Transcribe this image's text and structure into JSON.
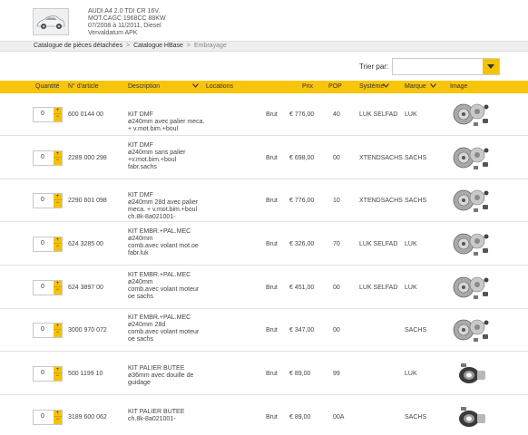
{
  "vehicle": {
    "lines": [
      "AUDI A4 2.0 TDI CR 16V.",
      "MOT.CAGC 1968CC 88KW",
      "07/2008 à 11/2011, Diesel",
      "Vervaldatum APK"
    ]
  },
  "breadcrumb": {
    "item1": "Catalogue de pièces détachées",
    "item2": "Catalogue HBase",
    "current": "Embrayage",
    "sep": ">"
  },
  "sort": {
    "label": "Trier par:",
    "value": ""
  },
  "columns": {
    "quantite": "Quantité",
    "article": "N° d'article",
    "description": "Description",
    "locations": "Locations",
    "prix": "Prix",
    "pop": "POP",
    "systeme": "Système",
    "marque": "Marque",
    "image": "Image"
  },
  "rows": [
    {
      "qty": "0",
      "article": "600 0144 00",
      "desc": [
        "KIT DMF",
        "ø240mm avec palier meca.",
        "+ v.mot.bim.+boul"
      ],
      "type": "Brut",
      "price": "€ 776,00",
      "pop": "40",
      "system": "LUK SELFAD",
      "brand": "LUK",
      "image": "clutch-kit-image"
    },
    {
      "qty": "0",
      "article": "2289 000 298",
      "desc": [
        "KIT DMF",
        "ø240mm sans palier",
        "+v.mot.bim.+boul",
        "fabr.sachs"
      ],
      "type": "Brut",
      "price": "€ 698,00",
      "pop": "00",
      "system": "XTENDSACHS",
      "brand": "SACHS",
      "image": "clutch-kit-image"
    },
    {
      "qty": "0",
      "article": "2290 601 098",
      "desc": [
        "KIT DMF",
        "ø240mm 28d avec palier",
        "meca. + v.mot.bim.+boul",
        "ch.8k-8a021001-"
      ],
      "type": "Brut",
      "price": "€ 776,00",
      "pop": "10",
      "system": "XTENDSACHS",
      "brand": "SACHS",
      "image": "clutch-kit-image"
    },
    {
      "qty": "0",
      "article": "624 3285 00",
      "desc": [
        "KIT EMBR.+PAL.MEC",
        "ø240mm",
        "comb.avec volant mot.oe",
        "fabr.luk"
      ],
      "type": "Brut",
      "price": "€ 326,00",
      "pop": "70",
      "system": "LUK SELFAD",
      "brand": "LUK",
      "image": "clutch-kit-image"
    },
    {
      "qty": "0",
      "article": "624 3897 00",
      "desc": [
        "KIT EMBR.+PAL.MEC",
        "ø240mm",
        "comb.avec volant moteur",
        "oe sachs"
      ],
      "type": "Brut",
      "price": "€ 451,00",
      "pop": "00",
      "system": "LUK SELFAD",
      "brand": "LUK",
      "image": "clutch-kit-image"
    },
    {
      "qty": "0",
      "article": "3000 970 072",
      "desc": [
        "KIT EMBR.+PAL.MEC",
        "ø240mm 28d",
        "comb.avec volant moteur",
        "oe sachs"
      ],
      "type": "Brut",
      "price": "€ 347,00",
      "pop": "00",
      "system": "",
      "brand": "SACHS",
      "image": "clutch-kit-image"
    },
    {
      "qty": "0",
      "article": "500 1199 10",
      "desc": [
        "KIT PALIER BUTEE",
        "ø36mm avec douille de",
        "guidage"
      ],
      "type": "Brut",
      "price": "€ 89,00",
      "pop": "99",
      "system": "",
      "brand": "LUK",
      "image": "release-bearing-image"
    },
    {
      "qty": "0",
      "article": "3189 600 062",
      "desc": [
        "KIT PALIER BUTEE",
        "ch.8k-8a021001-"
      ],
      "type": "Brut",
      "price": "€ 89,00",
      "pop": "00A",
      "system": "",
      "brand": "SACHS",
      "image": "release-bearing-image"
    }
  ],
  "colors": {
    "accent": "#f8c50b",
    "stepper": "#f5c200"
  }
}
